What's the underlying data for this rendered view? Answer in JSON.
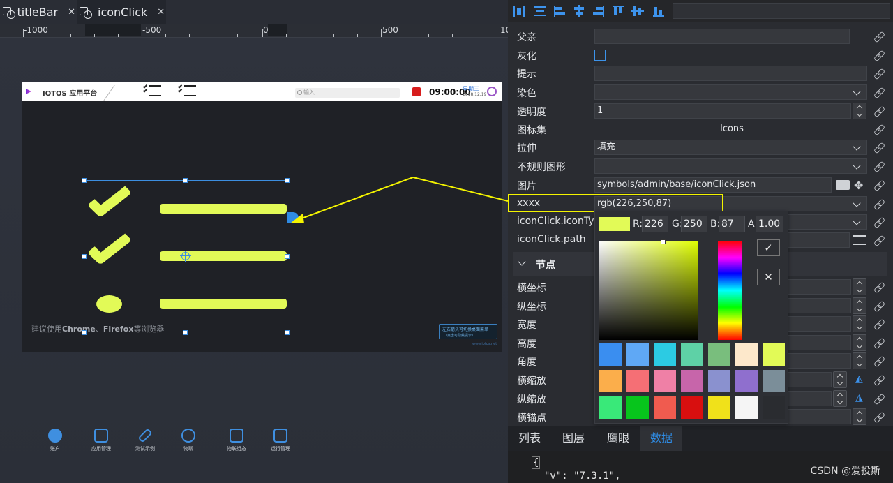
{
  "tabs": [
    {
      "label": "titleBar",
      "close": "✕"
    },
    {
      "label": "iconClick",
      "close": "✕"
    }
  ],
  "ruler": {
    "labels": [
      "-1000",
      "-500",
      "0",
      "500",
      "10"
    ]
  },
  "preview": {
    "app_title": "IOTOS 应用平台",
    "search_placeholder": "输入",
    "time": "09:00:00",
    "weekday": "星期三",
    "date": "2018.12.19",
    "browser_hint_prefix": "建议使用",
    "browser_hint_b1": "Chrome",
    "browser_hint_sep": "、",
    "browser_hint_b2": "Firefox",
    "browser_hint_suffix": "等浏览器",
    "tip_line1": "左右箭头可切换桌面菜单",
    "tip_line2": "（点击可隐藏提示）",
    "url": "www.iotos.net"
  },
  "bottom_nav": [
    "账户",
    "应用管理",
    "测试示例",
    "物聊",
    "物联组态",
    "运行管理"
  ],
  "props": {
    "parent": "父亲",
    "gray": "灰化",
    "tooltip": "提示",
    "dye": "染色",
    "opacity": {
      "label": "透明度",
      "value": "1"
    },
    "icon_set": {
      "label": "图标集",
      "value": "Icons"
    },
    "stretch": {
      "label": "拉伸",
      "value": "填充"
    },
    "irregular": "不规则图形",
    "image": {
      "label": "图片",
      "value": "symbols/admin/base/iconClick.json"
    },
    "xxxx": {
      "label": "xxxx",
      "value": "rgb(226,250,87)"
    },
    "icon_type": "iconClick.iconType",
    "icon_path": "iconClick.path",
    "section": "节点",
    "x": "横坐标",
    "y": "纵坐标",
    "width": "宽度",
    "height": "高度",
    "angle": "角度",
    "scale_x": "横缩放",
    "scale_y": "纵缩放",
    "anchor_x": "横锚点"
  },
  "picker": {
    "r_label": "R:",
    "r": "226",
    "g_label": "G:",
    "g": "250",
    "b_label": "B:",
    "b": "87",
    "a_label": "A:",
    "a": "1.00",
    "ok": "✓",
    "cancel": "✕",
    "palette": [
      "#3a8ef0",
      "#5fa8f5",
      "#2ccbe3",
      "#5ed1a6",
      "#79be7d",
      "#fde8cb",
      "#e2fa57",
      "#fbae4b",
      "#f56f75",
      "#ef80a6",
      "#c765aa",
      "#8a91cf",
      "#8f6fce",
      "#7b8e99",
      "#39e979",
      "#07c51c",
      "#f05b4f",
      "#d80f0f",
      "#f0e11a",
      "#f5f5f5",
      "#2a2c30"
    ],
    "current": "#e2fa57"
  },
  "bottom_tabs": [
    "列表",
    "图层",
    "鹰眼",
    "数据"
  ],
  "json_preview": {
    "line1": "{",
    "line2": "\"v\": \"7.3.1\","
  },
  "watermark": "CSDN @爱投斯"
}
